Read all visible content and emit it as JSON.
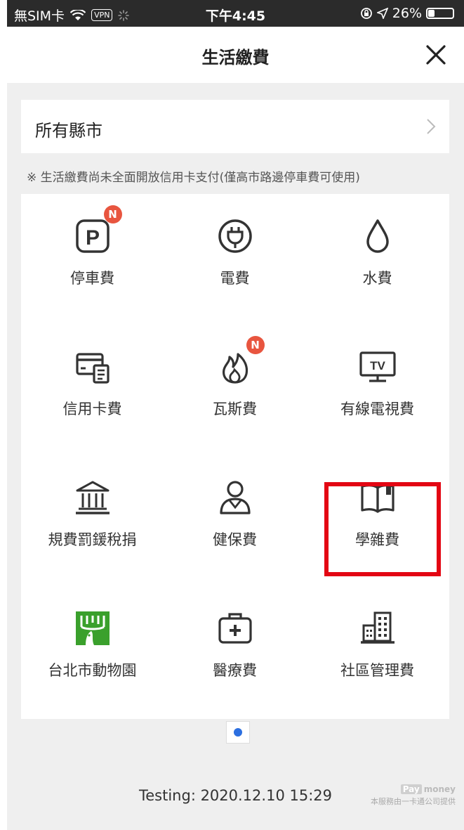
{
  "status_bar": {
    "carrier": "無SIM卡",
    "vpn": "VPN",
    "time": "下午4:45",
    "battery": "26%",
    "battery_level": 0.26
  },
  "header": {
    "title": "生活繳費",
    "close_icon": "close-icon"
  },
  "region": {
    "label": "所有縣市",
    "chevron_icon": "chevron-right-icon"
  },
  "notice": "※ 生活繳費尚未全面開放信用卡支付(僅高市路邊停車費可使用)",
  "tiles": [
    {
      "label": "停車費",
      "icon": "parking-icon",
      "badge": "N"
    },
    {
      "label": "電費",
      "icon": "plug-icon"
    },
    {
      "label": "水費",
      "icon": "water-drop-icon"
    },
    {
      "label": "信用卡費",
      "icon": "credit-card-icon"
    },
    {
      "label": "瓦斯費",
      "icon": "flame-icon",
      "badge": "N"
    },
    {
      "label": "有線電視費",
      "icon": "tv-icon"
    },
    {
      "label": "規費罰鍰稅捐",
      "icon": "government-building-icon"
    },
    {
      "label": "健保費",
      "icon": "person-icon"
    },
    {
      "label": "學雜費",
      "icon": "book-icon",
      "highlighted": true
    },
    {
      "label": "台北市動物園",
      "icon": "zoo-logo-icon"
    },
    {
      "label": "醫療費",
      "icon": "medical-kit-icon"
    },
    {
      "label": "社區管理費",
      "icon": "building-icon"
    }
  ],
  "pager": {
    "current_page": 1,
    "total_pages": 1
  },
  "footer": {
    "testing": "Testing: 2020.12.10 15:29",
    "brand_pay": "Pay",
    "brand_money": "money",
    "brand_caption": "本服務由一卡通公司提供"
  },
  "colors": {
    "accent_blue": "#2c6fe0",
    "badge_red": "#e8553f",
    "highlight_red": "#e30613",
    "zoo_green": "#3aa02c",
    "background": "#efefef"
  }
}
